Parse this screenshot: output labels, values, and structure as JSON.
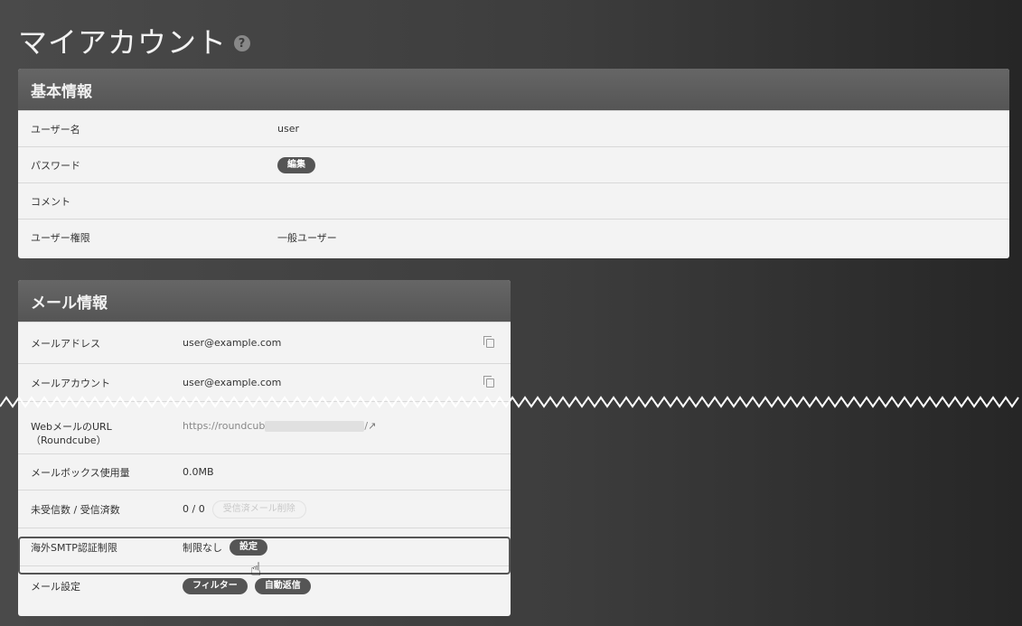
{
  "page": {
    "title": "マイアカウント",
    "help_icon": "?"
  },
  "basic": {
    "header": "基本情報",
    "rows": [
      {
        "label": "ユーザー名",
        "value": "user"
      },
      {
        "label": "パスワード",
        "button": "編集"
      },
      {
        "label": "コメント",
        "value": ""
      },
      {
        "label": "ユーザー権限",
        "value": "一般ユーザー"
      }
    ]
  },
  "mail": {
    "header": "メール情報",
    "rows": [
      {
        "label": "メールアドレス",
        "value": "user@example.com"
      },
      {
        "label": "メールアカウント",
        "value": "user@example.com"
      },
      {
        "label": "WebメールのURL",
        "label2": "（Roundcube）",
        "value": "https://roundcub",
        "value_suffix": "/"
      },
      {
        "label": "メールボックス使用量",
        "value": "0.0MB"
      },
      {
        "label": "未受信数 / 受信済数",
        "value": "0 / 0",
        "button": "受信済メール削除"
      },
      {
        "label": "海外SMTP認証制限",
        "value": "制限なし",
        "button": "設定"
      },
      {
        "label": "メール設定",
        "buttons": [
          "フィルター",
          "自動返信"
        ]
      }
    ]
  },
  "icons": {
    "copy": "copy-icon",
    "external": "external-link-icon",
    "cursor": "hand-pointer-icon"
  },
  "colors": {
    "background": "#3d3d3d",
    "panel": "#f3f3f3",
    "header": "#5a5a5a",
    "button": "#555555"
  }
}
